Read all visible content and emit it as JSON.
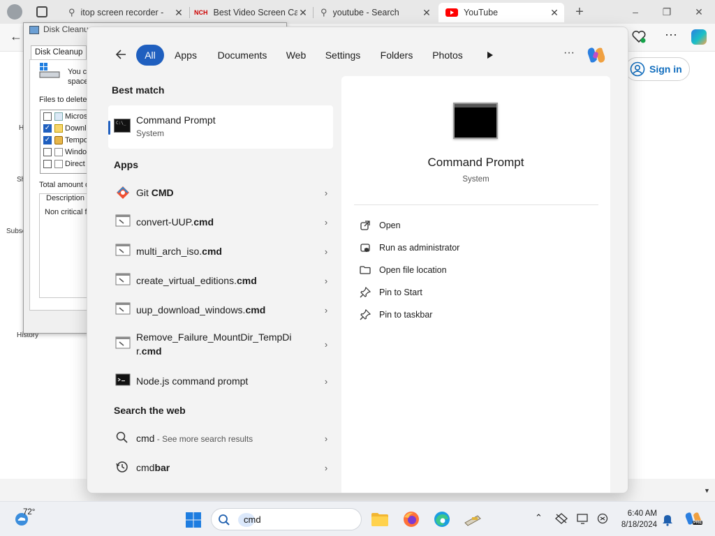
{
  "browser": {
    "tabs": [
      {
        "title": "itop screen recorder -",
        "icon": "search-icon"
      },
      {
        "title": "Best Video Screen Ca",
        "icon": "nch-logo-icon",
        "logo_text": "NCH"
      },
      {
        "title": "youtube - Search",
        "icon": "search-icon"
      },
      {
        "title": "YouTube",
        "icon": "youtube-icon",
        "active": true
      }
    ],
    "new_tab": "+",
    "window_controls": [
      "–",
      "❐",
      "✕"
    ],
    "sign_in_label": "Sign in",
    "colors": {
      "accent": "#1f5fbf",
      "youtube_red": "#ff0000"
    }
  },
  "disk_cleanup": {
    "title": "Disk Cleanup",
    "tab_label": "Disk Cleanup",
    "intro_text_line1": "You c",
    "intro_text_line2": "space",
    "files_to_delete_label": "Files to delete:",
    "files": [
      {
        "name": "Micros",
        "checked": false
      },
      {
        "name": "Downl",
        "checked": true
      },
      {
        "name": "Tempo",
        "checked": true,
        "locked": true
      },
      {
        "name": "Windo",
        "checked": false
      },
      {
        "name": "Direct",
        "checked": false
      }
    ],
    "total_amount_label": "Total amount o",
    "description_label": "Description",
    "description_text": "Non critical fi"
  },
  "page_sidebar": {
    "labels": [
      "H",
      "Sh",
      "Subsc",
      "History"
    ]
  },
  "search_panel": {
    "filters": [
      "All",
      "Apps",
      "Documents",
      "Web",
      "Settings",
      "Folders",
      "Photos"
    ],
    "active_filter": "All",
    "more_label": "···",
    "best_match_heading": "Best match",
    "best_match": {
      "name": "Command Prompt",
      "type": "System"
    },
    "apps_heading": "Apps",
    "apps": [
      {
        "prefix": "Git ",
        "bold": "CMD",
        "icon": "git-icon"
      },
      {
        "prefix": "convert-UUP.",
        "bold": "cmd",
        "icon": "cmd-script-icon"
      },
      {
        "prefix": "multi_arch_iso.",
        "bold": "cmd",
        "icon": "cmd-script-icon"
      },
      {
        "prefix": "create_virtual_editions.",
        "bold": "cmd",
        "icon": "cmd-script-icon"
      },
      {
        "prefix": "uup_download_windows.",
        "bold": "cmd",
        "icon": "cmd-script-icon"
      },
      {
        "line1": "Remove_Failure_MountDir_TempDi",
        "line2_prefix": "r.",
        "bold": "cmd",
        "icon": "cmd-script-icon"
      },
      {
        "prefix": "Node.js command prompt",
        "bold": "",
        "icon": "terminal-icon"
      }
    ],
    "web_heading": "Search the web",
    "web_results": [
      {
        "query": "cmd",
        "suffix": " - See more search results",
        "icon": "search-icon"
      },
      {
        "query_prefix": "cmd",
        "query_bold": "bar",
        "icon": "history-icon"
      }
    ],
    "detail": {
      "name": "Command Prompt",
      "type": "System",
      "actions": [
        {
          "label": "Open",
          "icon": "open-external-icon"
        },
        {
          "label": "Run as administrator",
          "icon": "shield-admin-icon"
        },
        {
          "label": "Open file location",
          "icon": "folder-icon"
        },
        {
          "label": "Pin to Start",
          "icon": "pin-icon"
        },
        {
          "label": "Pin to taskbar",
          "icon": "pin-icon"
        }
      ]
    }
  },
  "taskbar": {
    "weather_temp": "72°",
    "search_value": "cmd",
    "time": "6:40 AM",
    "date": "8/18/2024",
    "copilot_badge": "PRE"
  }
}
